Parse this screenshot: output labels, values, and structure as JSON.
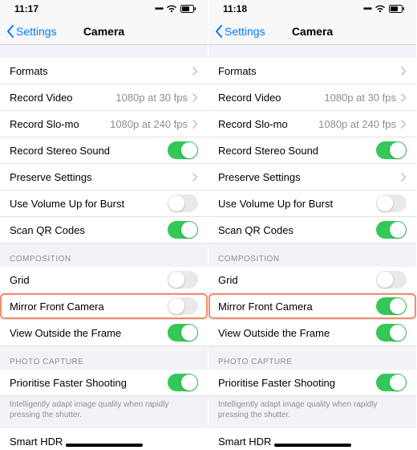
{
  "phones": [
    {
      "time": "11:17",
      "back_label": "Settings",
      "title": "Camera",
      "mirror_on": false
    },
    {
      "time": "11:18",
      "back_label": "Settings",
      "title": "Camera",
      "mirror_on": true
    }
  ],
  "rows": {
    "formats": "Formats",
    "record_video": "Record Video",
    "record_video_detail": "1080p at 30 fps",
    "record_slomo": "Record Slo-mo",
    "record_slomo_detail": "1080p at 240 fps",
    "stereo": "Record Stereo Sound",
    "preserve": "Preserve Settings",
    "volume_burst": "Use Volume Up for Burst",
    "qr": "Scan QR Codes",
    "composition_header": "COMPOSITION",
    "grid": "Grid",
    "mirror": "Mirror Front Camera",
    "outside_frame": "View Outside the Frame",
    "photo_capture_header": "PHOTO CAPTURE",
    "prioritise": "Prioritise Faster Shooting",
    "prioritise_footer": "Intelligently adapt image quality when rapidly pressing the shutter.",
    "smart_hdr": "Smart HDR"
  },
  "toggles": {
    "stereo": true,
    "volume_burst": false,
    "qr": true,
    "grid": false,
    "outside_frame": true,
    "prioritise": true
  }
}
